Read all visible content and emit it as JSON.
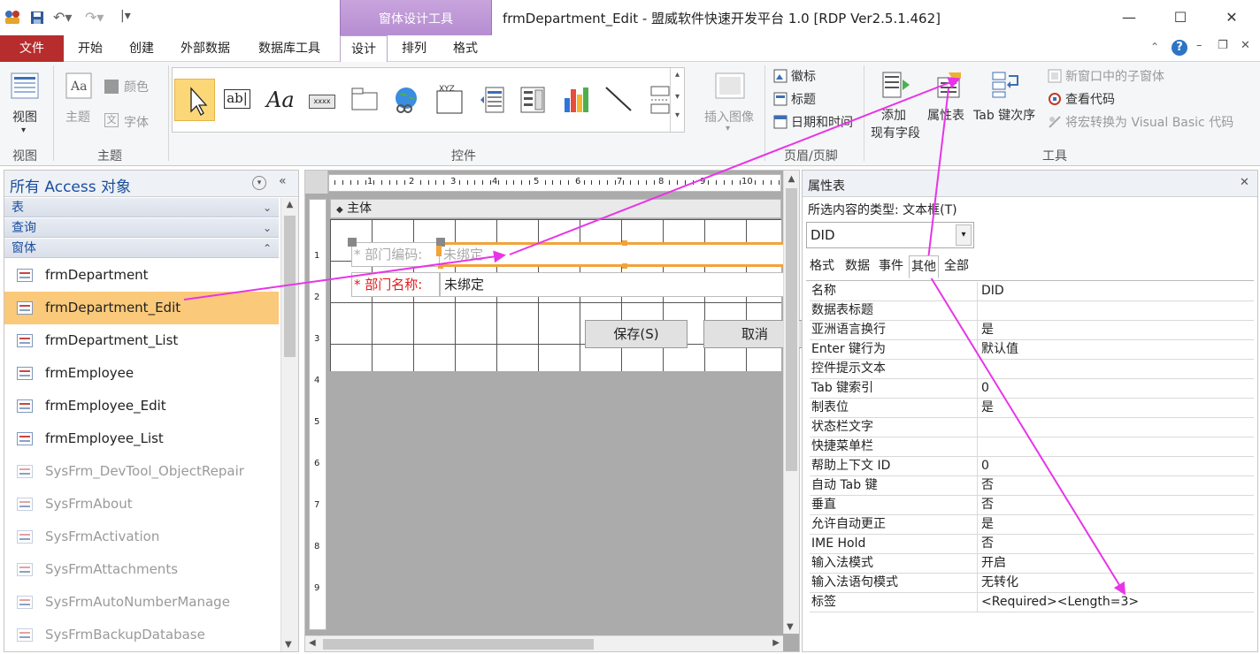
{
  "window": {
    "title": "frmDepartment_Edit - 盟威软件快速开发平台 1.0 [RDP Ver2.5.1.462]",
    "context_tab": "窗体设计工具",
    "min": "—",
    "max": "☐",
    "close": "✕"
  },
  "tabs": {
    "file": "文件",
    "items": [
      "开始",
      "创建",
      "外部数据",
      "数据库工具",
      "设计",
      "排列",
      "格式"
    ]
  },
  "ribbon": {
    "view": {
      "label": "视图",
      "group": "视图"
    },
    "theme": {
      "label": "主题",
      "colors": "颜色",
      "fonts": "字体",
      "group": "主题"
    },
    "controls": {
      "group": "控件",
      "insert_image": "插入图像"
    },
    "header_footer": {
      "group": "页眉/页脚",
      "logo": "徽标",
      "title": "标题",
      "datetime": "日期和时间"
    },
    "tools": {
      "group": "工具",
      "add_fields_1": "添加",
      "add_fields_2": "现有字段",
      "property_sheet": "属性表",
      "tab_order": "Tab 键次序",
      "subform": "新窗口中的子窗体",
      "view_code": "查看代码",
      "convert_macros": "将宏转换为 Visual Basic 代码"
    }
  },
  "nav": {
    "title": "所有 Access 对象",
    "groups": [
      "表",
      "查询",
      "窗体"
    ],
    "items": [
      {
        "label": "frmDepartment",
        "sys": false
      },
      {
        "label": "frmDepartment_Edit",
        "sys": false
      },
      {
        "label": "frmDepartment_List",
        "sys": false
      },
      {
        "label": "frmEmployee",
        "sys": false
      },
      {
        "label": "frmEmployee_Edit",
        "sys": false
      },
      {
        "label": "frmEmployee_List",
        "sys": false
      },
      {
        "label": "SysFrm_DevTool_ObjectRepair",
        "sys": true
      },
      {
        "label": "SysFrmAbout",
        "sys": true
      },
      {
        "label": "SysFrmActivation",
        "sys": true
      },
      {
        "label": "SysFrmAttachments",
        "sys": true
      },
      {
        "label": "SysFrmAutoNumberManage",
        "sys": true
      },
      {
        "label": "SysFrmBackupDatabase",
        "sys": true
      }
    ],
    "selected": 1
  },
  "designer": {
    "section": "主体",
    "ruler": [
      "1",
      "2",
      "3",
      "4",
      "5",
      "6",
      "7",
      "8",
      "9",
      "10"
    ],
    "vruler": [
      "1",
      "2",
      "3",
      "4",
      "5",
      "6",
      "7",
      "8",
      "9"
    ],
    "field1_label": "* 部门编码:",
    "field1_value": "未绑定",
    "field2_label": "* 部门名称:",
    "field2_value": "未绑定",
    "save": "保存(S)",
    "cancel": "取消"
  },
  "props": {
    "title": "属性表",
    "selection_type": "所选内容的类型: 文本框(T)",
    "combo": "DID",
    "tabs": [
      "格式",
      "数据",
      "事件",
      "其他",
      "全部"
    ],
    "active_tab": 3,
    "rows": [
      {
        "name": "名称",
        "value": "DID"
      },
      {
        "name": "数据表标题",
        "value": ""
      },
      {
        "name": "亚洲语言换行",
        "value": "是"
      },
      {
        "name": "Enter 键行为",
        "value": "默认值"
      },
      {
        "name": "控件提示文本",
        "value": ""
      },
      {
        "name": "Tab 键索引",
        "value": "0"
      },
      {
        "name": "制表位",
        "value": "是"
      },
      {
        "name": "状态栏文字",
        "value": ""
      },
      {
        "name": "快捷菜单栏",
        "value": ""
      },
      {
        "name": "帮助上下文 ID",
        "value": "0"
      },
      {
        "name": "自动 Tab 键",
        "value": "否"
      },
      {
        "name": "垂直",
        "value": "否"
      },
      {
        "name": "允许自动更正",
        "value": "是"
      },
      {
        "name": "IME Hold",
        "value": "否"
      },
      {
        "name": "输入法模式",
        "value": "开启"
      },
      {
        "name": "输入法语句模式",
        "value": "无转化"
      },
      {
        "name": "标签",
        "value": "<Required><Length=3>"
      }
    ]
  },
  "colors": {
    "accent": "#b72c2c",
    "arrow": "#e834e8",
    "selected": "#fbc97a",
    "context": "#b48bd0"
  }
}
